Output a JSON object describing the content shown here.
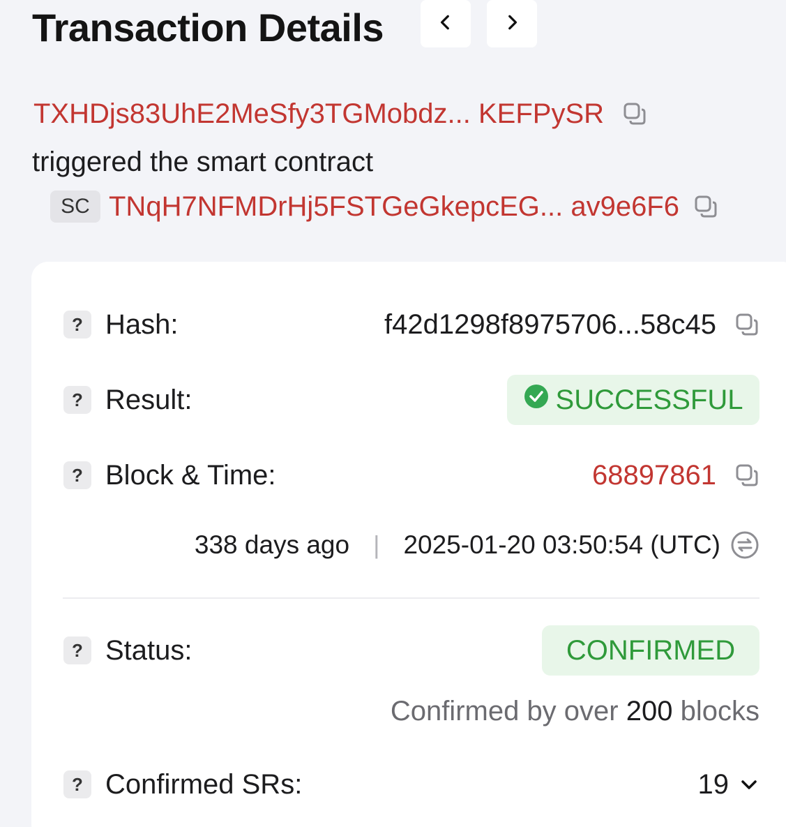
{
  "header": {
    "title": "Transaction Details",
    "prev_icon": "chevron-left-icon",
    "next_icon": "chevron-right-icon"
  },
  "summary": {
    "from_address": "TXHDjs83UhE2MeSfy3TGMobdz... KEFPySR",
    "action_text": "triggered the smart contract",
    "contract_badge": "SC",
    "contract_address": "TNqH7NFMDrHj5FSTGeGkepcEG... av9e6F6"
  },
  "details": {
    "help_badge": "?",
    "hash": {
      "label": "Hash:",
      "value": "f42d1298f8975706...58c45"
    },
    "result": {
      "label": "Result:",
      "value": "SUCCESSFUL",
      "icon": "check-circle-icon"
    },
    "block": {
      "label": "Block & Time:",
      "value": "68897861",
      "relative_time": "338 days ago",
      "separator": "|",
      "timestamp": "2025-01-20 03:50:54 (UTC)"
    },
    "status": {
      "label": "Status:",
      "value": "CONFIRMED",
      "note_prefix": "Confirmed by over",
      "note_count": "200",
      "note_suffix": "blocks"
    },
    "srs": {
      "label": "Confirmed SRs:",
      "value": "19"
    }
  },
  "colors": {
    "accent_red": "#c23631",
    "success_green": "#2f9a3a",
    "success_bg": "#e8f6e9",
    "page_bg": "#f3f4f8"
  }
}
